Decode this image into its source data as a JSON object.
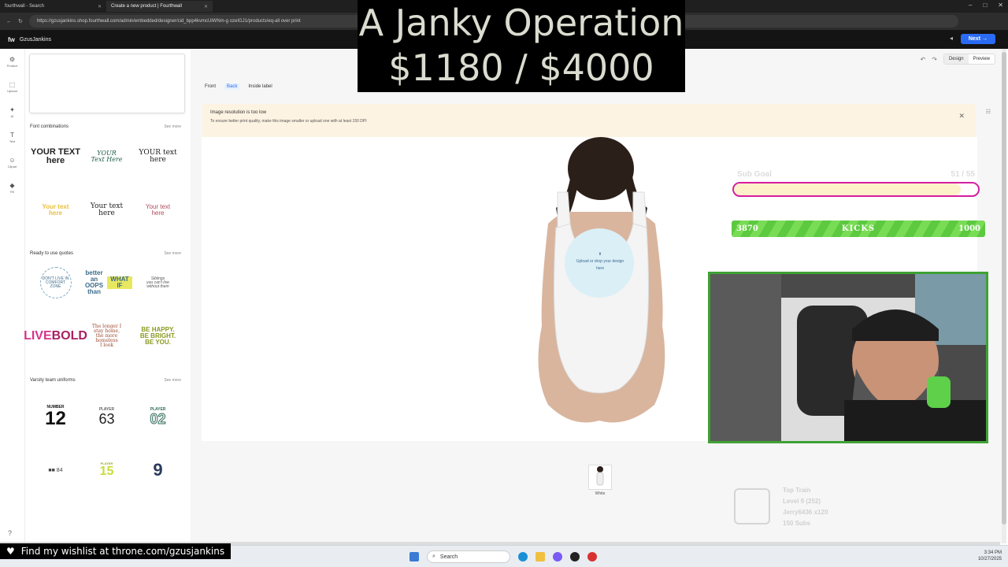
{
  "browser": {
    "tabs": [
      {
        "label": "fourthwall - Search",
        "active": false
      },
      {
        "label": "Create a new product | Fourthwall",
        "active": true
      }
    ],
    "url": "https://gzusjankins.shop.fourthwall.com/admin/embedded/designer/cid_bpp4kvmcUiWNm-g ozeIGJ1/products/eq-all over print"
  },
  "app": {
    "logo": "fw",
    "store_name": "GzusJankins",
    "next_label": "Next"
  },
  "rail": {
    "items": [
      {
        "label": "Product",
        "icon": "product-icon",
        "glyph": "⚙"
      },
      {
        "label": "Upload",
        "icon": "upload-icon",
        "glyph": "⬚"
      },
      {
        "label": "AI",
        "icon": "ai-icon",
        "glyph": "✦"
      },
      {
        "label": "Text",
        "icon": "text-icon",
        "glyph": "T"
      },
      {
        "label": "Clipart",
        "icon": "clipart-icon",
        "glyph": "☺"
      },
      {
        "label": "Fill",
        "icon": "fill-icon",
        "glyph": "◆"
      }
    ]
  },
  "panel": {
    "font_combos": {
      "title": "Font combinations",
      "see_all": "See more"
    },
    "quotes": {
      "title": "Ready to use quotes",
      "see_all": "See more"
    },
    "varsity": {
      "title": "Varsity team uniforms",
      "see_all": "See more"
    }
  },
  "canvas": {
    "mode_design": "Design",
    "mode_preview": "Preview",
    "side_tabs": [
      "Front",
      "Back",
      "Inside label"
    ],
    "warning_title": "Image resolution is too low",
    "warning_desc": "To ensure better print quality, make this image smaller or upload one with at least 150 DPI",
    "upload_hint": "Upload or drop your design here",
    "thumb_label": "White"
  },
  "overlay": {
    "title_line1": "A Janky Operation",
    "title_line2": "$1180 / $4000",
    "sub_goal_label": "Sub Goal",
    "sub_goal_count": "51 / 55",
    "sub_goal_progress": 0.93,
    "kicks_left": "3870",
    "kicks_label": "KICKS",
    "kicks_right": "1000",
    "train_title": "Top Train",
    "train_level": "Level 9  (252)",
    "train_user": "Jerry6436 x120",
    "train_subs": "150 Subs",
    "wishlist": "Find my wishlist at throne.com/gzusjankins"
  },
  "taskbar": {
    "search_placeholder": "Search",
    "time": "3:34 PM",
    "date": "10/27/2025"
  },
  "colors": {
    "next_button": "#2b6bf3",
    "warning_bg": "#fdf3e2",
    "sub_goal_border": "#d61ea0",
    "kicks_green": "#5cc940",
    "cam_border": "#3ea234"
  }
}
